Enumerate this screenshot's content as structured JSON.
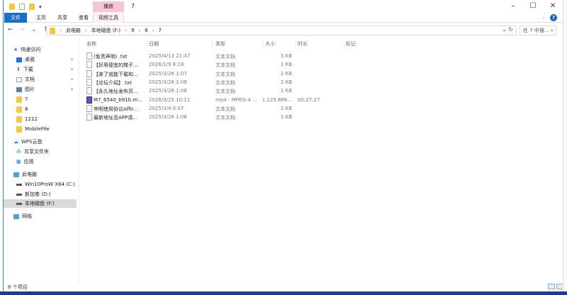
{
  "window": {
    "title": "7",
    "contextual_tab": "播放",
    "minimize": "–",
    "maximize": "☐",
    "close": "✕"
  },
  "ribbon": {
    "tabs": [
      "文件",
      "主页",
      "共享",
      "查看",
      "视频工具"
    ],
    "help": "?",
    "collapse": "⌄"
  },
  "address": {
    "back": "←",
    "forward": "→",
    "recent": "⌄",
    "up": "↑",
    "path": [
      "此电脑",
      "本地磁盘 (F:)",
      "9",
      "8",
      "7"
    ],
    "sep": "›",
    "dropdown": "⌄",
    "refresh": "↻",
    "search_placeholder": "在 7 中搜... ⌕"
  },
  "sidebar": {
    "items": [
      {
        "label": "快速访问",
        "icon": "star-icon"
      },
      {
        "label": "桌面",
        "icon": "desktop-icon",
        "pinned": true
      },
      {
        "label": "下载",
        "icon": "download-icon",
        "pinned": true
      },
      {
        "label": "文档",
        "icon": "document-icon",
        "pinned": true
      },
      {
        "label": "图片",
        "icon": "pictures-icon",
        "pinned": true
      },
      {
        "label": "7",
        "icon": "folder-icon"
      },
      {
        "label": "8",
        "icon": "folder-icon"
      },
      {
        "label": "1212",
        "icon": "folder-icon"
      },
      {
        "label": "MobileFile",
        "icon": "folder-icon"
      },
      {
        "label": "WPS云盘",
        "icon": "cloud-icon"
      },
      {
        "label": "共享文件夹",
        "icon": "share-icon"
      },
      {
        "label": "应用",
        "icon": "apps-icon"
      },
      {
        "label": "此电脑",
        "icon": "computer-icon"
      },
      {
        "label": "Win10ProW X64 (C:)",
        "icon": "drive-icon"
      },
      {
        "label": "新加卷 (D:)",
        "icon": "drive-icon"
      },
      {
        "label": "本地磁盘 (F:)",
        "icon": "drive-icon",
        "selected": true
      },
      {
        "label": "网络",
        "icon": "network-icon"
      }
    ],
    "pin": "📌"
  },
  "columns": [
    "名称",
    "日期",
    "类型",
    "大小",
    "时长",
    "标记"
  ],
  "files": [
    {
      "name": "(免责声明) .txt",
      "date": "2025/4/13 21:47",
      "type": "文本文档",
      "size": "3 KB",
      "duration": ""
    },
    {
      "name": "【好用便宜的梯子...",
      "date": "2026/1/9 8:18",
      "type": "文本文档",
      "size": "1 KB",
      "duration": ""
    },
    {
      "name": "【来了就能下载和...",
      "date": "2025/3/26 1:07",
      "type": "文本文档",
      "size": "2 KB",
      "duration": ""
    },
    {
      "name": "【论坛介绍】.txt",
      "date": "2025/3/26 1:08",
      "type": "文本文档",
      "size": "2 KB",
      "duration": ""
    },
    {
      "name": "【永久地址发布页...",
      "date": "2025/3/26 1:08",
      "type": "文本文档",
      "size": "1 KB",
      "duration": ""
    },
    {
      "name": "M7_6540_b91b.m...",
      "date": "2026/3/25 10:11",
      "type": "mp4 - MPEG-4 ...",
      "size": "1,125,886...",
      "duration": "00:27:27",
      "video": true
    },
    {
      "name": "申明使用协议Affir...",
      "date": "2025/3/4 0:07",
      "type": "文本文档",
      "size": "2 KB",
      "duration": ""
    },
    {
      "name": "最新地址及APP请...",
      "date": "2025/3/26 1:08",
      "type": "文本文档",
      "size": "1 KB",
      "duration": ""
    }
  ],
  "status": {
    "count": "8 个项目"
  },
  "colors": {
    "file_tab": "#1a6fc9",
    "contextual_tab": "#f7c4d8",
    "selection": "#d9d9d9"
  }
}
